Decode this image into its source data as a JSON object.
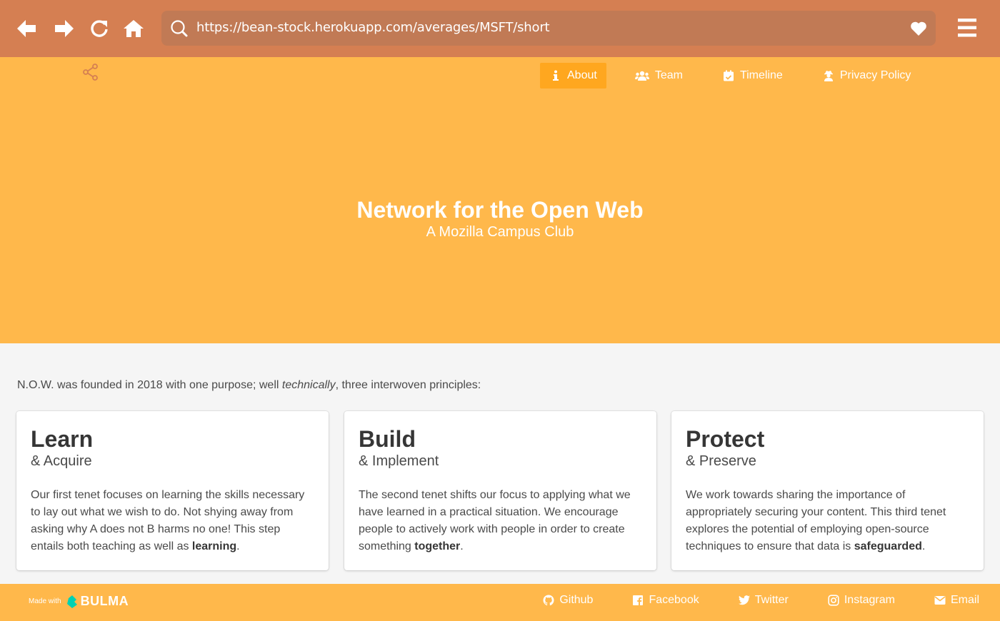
{
  "browser": {
    "url": "https://bean-stock.herokuapp.com/averages/MSFT/short"
  },
  "navbar": {
    "items": [
      {
        "label": "About",
        "icon": "info-icon",
        "active": true
      },
      {
        "label": "Team",
        "icon": "users-icon"
      },
      {
        "label": "Timeline",
        "icon": "calendar-check-icon"
      },
      {
        "label": "Privacy Policy",
        "icon": "user-secret-icon"
      }
    ]
  },
  "hero": {
    "title": "Network for the Open Web",
    "subtitle": "A Mozilla Campus Club"
  },
  "intro": {
    "before": "N.O.W. was founded in 2018 with one purpose; well ",
    "emphasis": "technically",
    "after": ", three interwoven principles:"
  },
  "cards": [
    {
      "title": "Learn",
      "subtitle": "& Acquire",
      "text": "Our first tenet focuses on learning the skills necessary to lay out what we wish to do. Not shying away from asking why A does not B harms no one! This step entails both teaching as well as ",
      "strong": "learning",
      "end": "."
    },
    {
      "title": "Build",
      "subtitle": "& Implement",
      "text": "The second tenet shifts our focus to applying what we have learned in a practical situation. We encourage people to actively work with people in order to create something ",
      "strong": "together",
      "end": "."
    },
    {
      "title": "Protect",
      "subtitle": "& Preserve",
      "text": "We work towards sharing the importance of appropriately securing your content. This third tenet explores the potential of employing open-source techniques to ensure that data is ",
      "strong": "safeguarded",
      "end": "."
    }
  ],
  "footer": {
    "made_with": "Made with",
    "brand": "BULMA",
    "links": [
      {
        "label": "Github",
        "icon": "github-icon"
      },
      {
        "label": "Facebook",
        "icon": "facebook-icon"
      },
      {
        "label": "Twitter",
        "icon": "twitter-icon"
      },
      {
        "label": "Instagram",
        "icon": "instagram-icon"
      },
      {
        "label": "Email",
        "icon": "envelope-icon"
      }
    ]
  },
  "colors": {
    "chrome": "#d57f52",
    "hero": "#ffb84b",
    "active_nav": "#ffa71f",
    "body_bg": "#f5f5f5",
    "bulma_accent": "#00d1b2"
  }
}
